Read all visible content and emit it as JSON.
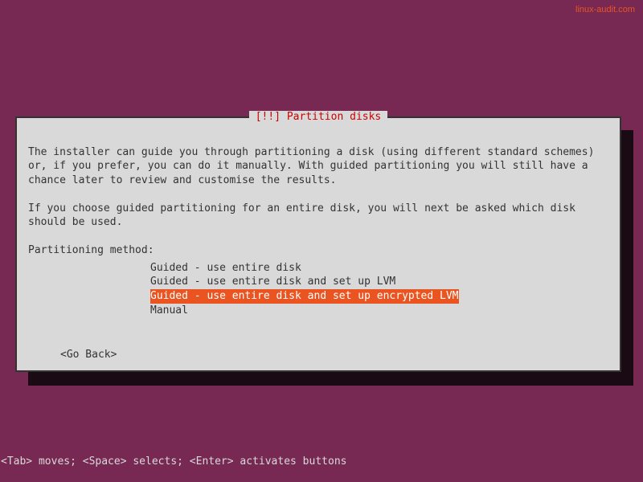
{
  "attribution": "linux-audit.com",
  "dialog": {
    "title": "[!!] Partition disks",
    "paragraph1": "The installer can guide you through partitioning a disk (using different standard schemes) or, if you prefer, you can do it manually. With guided partitioning you will still have a chance later to review and customise the results.",
    "paragraph2": "If you choose guided partitioning for an entire disk, you will next be asked which disk should be used.",
    "prompt": "Partitioning method:",
    "options": [
      "Guided - use entire disk",
      "Guided - use entire disk and set up LVM",
      "Guided - use entire disk and set up encrypted LVM",
      "Manual"
    ],
    "go_back": "<Go Back>"
  },
  "footer": "<Tab> moves; <Space> selects; <Enter> activates buttons"
}
